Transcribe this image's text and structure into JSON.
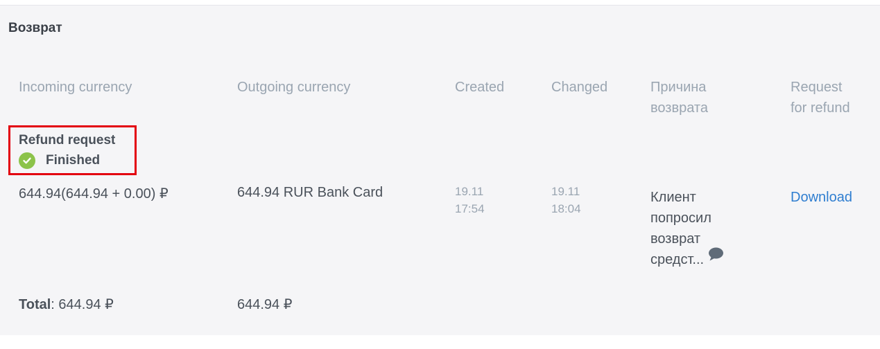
{
  "section": {
    "title": "Возврат"
  },
  "columns": [
    {
      "line1": "Incoming currency",
      "line2": ""
    },
    {
      "line1": "Outgoing currency",
      "line2": ""
    },
    {
      "line1": "Created",
      "line2": ""
    },
    {
      "line1": "Changed",
      "line2": ""
    },
    {
      "line1": "Причина",
      "line2": "возврата"
    },
    {
      "line1": "Request",
      "line2": "for refund"
    }
  ],
  "status": {
    "title": "Refund request",
    "label": "Finished",
    "icon": "check-circle-icon",
    "color": "#8cc34a"
  },
  "row": {
    "incoming": "644.94(644.94 + 0.00) ₽",
    "outgoing": "644.94 RUR Bank Card",
    "created_date": "19.11",
    "created_time": "17:54",
    "changed_date": "19.11",
    "changed_time": "18:04",
    "reason_lines": [
      "Клиент",
      "попросил",
      "возврат",
      "средст..."
    ],
    "reason_icon": "comment-icon",
    "action": "Download"
  },
  "total": {
    "label": "Total",
    "incoming_value": ": 644.94 ₽",
    "outgoing_value": "644.94 ₽"
  },
  "colors": {
    "highlight_border": "#e3000f",
    "link": "#2f7ed0",
    "header_text": "#9aa5b1"
  }
}
